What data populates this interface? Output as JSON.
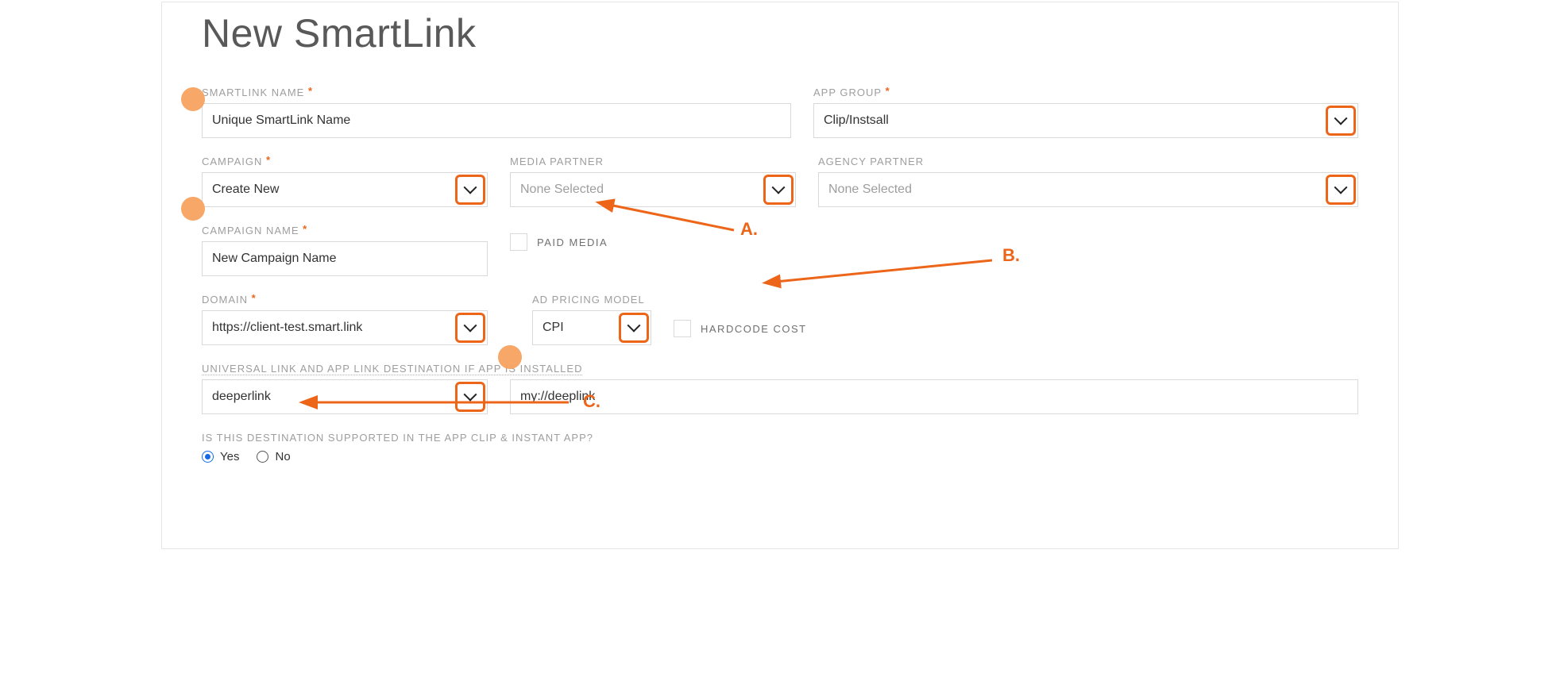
{
  "title": "New SmartLink",
  "fields": {
    "smartlink_name": {
      "label": "SMARTLINK NAME",
      "value": "Unique SmartLink Name"
    },
    "app_group": {
      "label": "APP GROUP",
      "value": "Clip/Instsall"
    },
    "campaign": {
      "label": "CAMPAIGN",
      "value": "Create New"
    },
    "media_partner": {
      "label": "MEDIA PARTNER",
      "value": "None Selected"
    },
    "agency_partner": {
      "label": "AGENCY PARTNER",
      "value": "None Selected"
    },
    "campaign_name": {
      "label": "CAMPAIGN NAME",
      "value": "New Campaign Name"
    },
    "paid_media": {
      "label": "PAID MEDIA"
    },
    "domain": {
      "label": "DOMAIN",
      "value": "https://client-test.smart.link"
    },
    "ad_pricing": {
      "label": "AD PRICING MODEL",
      "value": "CPI"
    },
    "hardcode_cost": {
      "label": "HARDCODE COST"
    },
    "ul_section": {
      "label": "UNIVERSAL LINK AND APP LINK DESTINATION IF APP IS INSTALLED"
    },
    "ul_select": {
      "value": "deeperlink"
    },
    "ul_input": {
      "value": "my://deeplink"
    },
    "clip_supported": {
      "label": "IS THIS DESTINATION SUPPORTED IN THE APP CLIP & INSTANT APP?",
      "options": {
        "yes": "Yes",
        "no": "No"
      },
      "selected": "yes"
    }
  },
  "annotations": {
    "a": "A.",
    "b": "B.",
    "c": "C."
  }
}
